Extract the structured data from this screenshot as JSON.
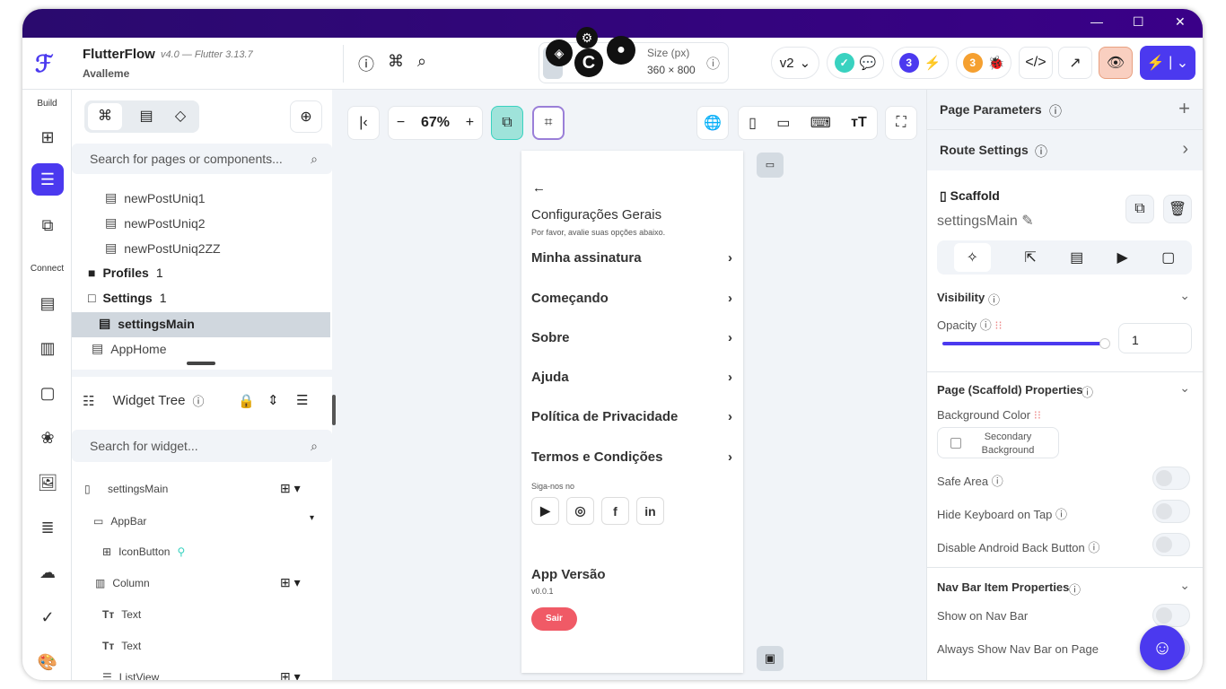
{
  "app": {
    "name": "FlutterFlow",
    "version": "v4.0 — Flutter 3.13.7",
    "project": "Avalleme"
  },
  "toolbar": {
    "size_label": "Size (px)",
    "size_value": "360 × 800",
    "version_select": "v2",
    "issues_count": "3",
    "bugs_count": "3",
    "accent": "#4b39ef"
  },
  "rail": {
    "build_label": "Build",
    "connect_label": "Connect"
  },
  "pages": {
    "search_placeholder": "Search for pages or components...",
    "items": [
      {
        "label": "newPostUniq1"
      },
      {
        "label": "newPostUniq2"
      },
      {
        "label": "newPostUniq2ZZ"
      },
      {
        "label": "Profiles",
        "count": "1"
      },
      {
        "label": "Settings",
        "count": "1"
      },
      {
        "label": "settingsMain"
      },
      {
        "label": "AppHome"
      }
    ]
  },
  "widget_tree": {
    "title": "Widget Tree",
    "search_placeholder": "Search for widget...",
    "nodes": [
      {
        "label": "settingsMain"
      },
      {
        "label": "AppBar"
      },
      {
        "label": "IconButton"
      },
      {
        "label": "Column"
      },
      {
        "label": "Text"
      },
      {
        "label": "Text"
      },
      {
        "label": "ListView"
      }
    ]
  },
  "canvas": {
    "zoom": "67%"
  },
  "phone": {
    "title": "Configurações Gerais",
    "subtitle": "Por favor, avalie suas opções abaixo.",
    "items": [
      "Minha assinatura",
      "Começando",
      "Sobre",
      "Ajuda",
      "Política de Privacidade",
      "Termos e Condições"
    ],
    "follow_label": "Siga-nos no",
    "version_title": "App Versão",
    "version": "v0.0.1",
    "logout": "Sair"
  },
  "props": {
    "page_params": "Page Parameters",
    "route_settings": "Route Settings",
    "widget_type": "Scaffold",
    "widget_name": "settingsMain",
    "visibility": "Visibility",
    "opacity_label": "Opacity",
    "opacity_value": "1",
    "opacity_fraction": 1,
    "scaffold_props": "Page (Scaffold) Properties",
    "bg_color_label": "Background Color",
    "bg_color_value": "Secondary Background",
    "safe_area": "Safe Area",
    "hide_keyboard": "Hide Keyboard on Tap",
    "disable_back": "Disable Android Back Button",
    "nav_bar_props": "Nav Bar Item Properties",
    "show_nav": "Show on Nav Bar",
    "always_show_nav": "Always Show Nav Bar on Page"
  }
}
